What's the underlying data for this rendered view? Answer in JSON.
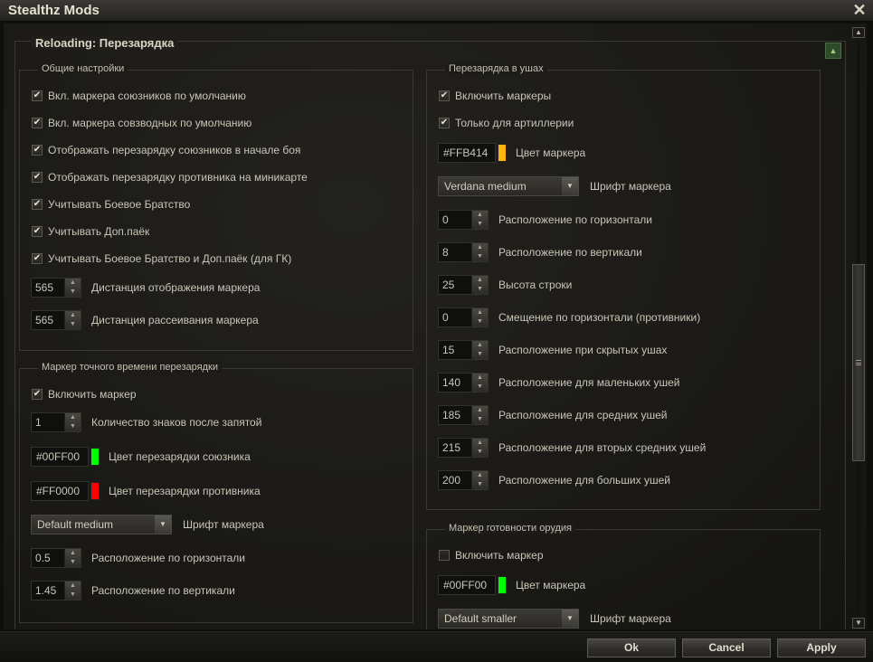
{
  "window": {
    "title": "Stealthz Mods"
  },
  "section": {
    "title": "Reloading: Перезарядка"
  },
  "general": {
    "title": "Общие настройки",
    "checkboxes": [
      {
        "label": "Вкл. маркера союзников по умолчанию",
        "checked": true
      },
      {
        "label": "Вкл. маркера совзводных по умолчанию",
        "checked": true
      },
      {
        "label": "Отображать перезарядку союзников в начале боя",
        "checked": true
      },
      {
        "label": "Отображать перезарядку противника на миникарте",
        "checked": true
      },
      {
        "label": "Учитывать Боевое Братство",
        "checked": true
      },
      {
        "label": "Учитывать Доп.паёк",
        "checked": true
      },
      {
        "label": "Учитывать Боевое Братство и Доп.паёк (для ГК)",
        "checked": true
      }
    ],
    "steppers": [
      {
        "value": "565",
        "label": "Дистанция отображения маркера"
      },
      {
        "value": "565",
        "label": "Дистанция рассеивания маркера"
      }
    ]
  },
  "precise": {
    "title": "Маркер точного времени перезарядки",
    "enable": {
      "label": "Включить маркер",
      "checked": true
    },
    "decimals": {
      "value": "1",
      "label": "Количество знаков после запятой"
    },
    "ally_color": {
      "hex": "#00FF00",
      "swatch": "#00ff00",
      "label": "Цвет перезарядки союзника"
    },
    "enemy_color": {
      "hex": "#FF0000",
      "swatch": "#ff0000",
      "label": "Цвет перезарядки противника"
    },
    "font": {
      "value": "Default medium",
      "label": "Шрифт маркера"
    },
    "pos_h": {
      "value": "0.5",
      "label": "Расположение по горизонтали"
    },
    "pos_v": {
      "value": "1.45",
      "label": "Расположение по вертикали"
    }
  },
  "ears": {
    "title": "Перезарядка в ушах",
    "enable": {
      "label": "Включить маркеры",
      "checked": true
    },
    "arty_only": {
      "label": "Только для артиллерии",
      "checked": true
    },
    "color": {
      "hex": "#FFB414",
      "swatch": "#ffb414",
      "label": "Цвет маркера"
    },
    "font": {
      "value": "Verdana medium",
      "label": "Шрифт маркера"
    },
    "steppers": [
      {
        "value": "0",
        "label": "Расположение по горизонтали"
      },
      {
        "value": "8",
        "label": "Расположение по вертикали"
      },
      {
        "value": "25",
        "label": "Высота строки"
      },
      {
        "value": "0",
        "label": "Смещение по горизонтали (противники)"
      },
      {
        "value": "15",
        "label": "Расположение при скрытых ушах"
      },
      {
        "value": "140",
        "label": "Расположение для маленьких ушей"
      },
      {
        "value": "185",
        "label": "Расположение для средних ушей"
      },
      {
        "value": "215",
        "label": "Расположение для вторых средних ушей"
      },
      {
        "value": "200",
        "label": "Расположение для больших ушей"
      }
    ]
  },
  "gun_ready": {
    "title": "Маркер готовности орудия",
    "enable": {
      "label": "Включить маркер",
      "checked": false
    },
    "color": {
      "hex": "#00FF00",
      "swatch": "#00ff00",
      "label": "Цвет маркера"
    },
    "font": {
      "value": "Default smaller",
      "label": "Шрифт маркера"
    }
  },
  "footer": {
    "ok": "Ok",
    "cancel": "Cancel",
    "apply": "Apply"
  },
  "icons": {
    "close": "close-icon",
    "collapse": "collapse-icon",
    "check": "checkmark-icon",
    "up": "arrow-up-icon",
    "down": "arrow-down-icon"
  }
}
